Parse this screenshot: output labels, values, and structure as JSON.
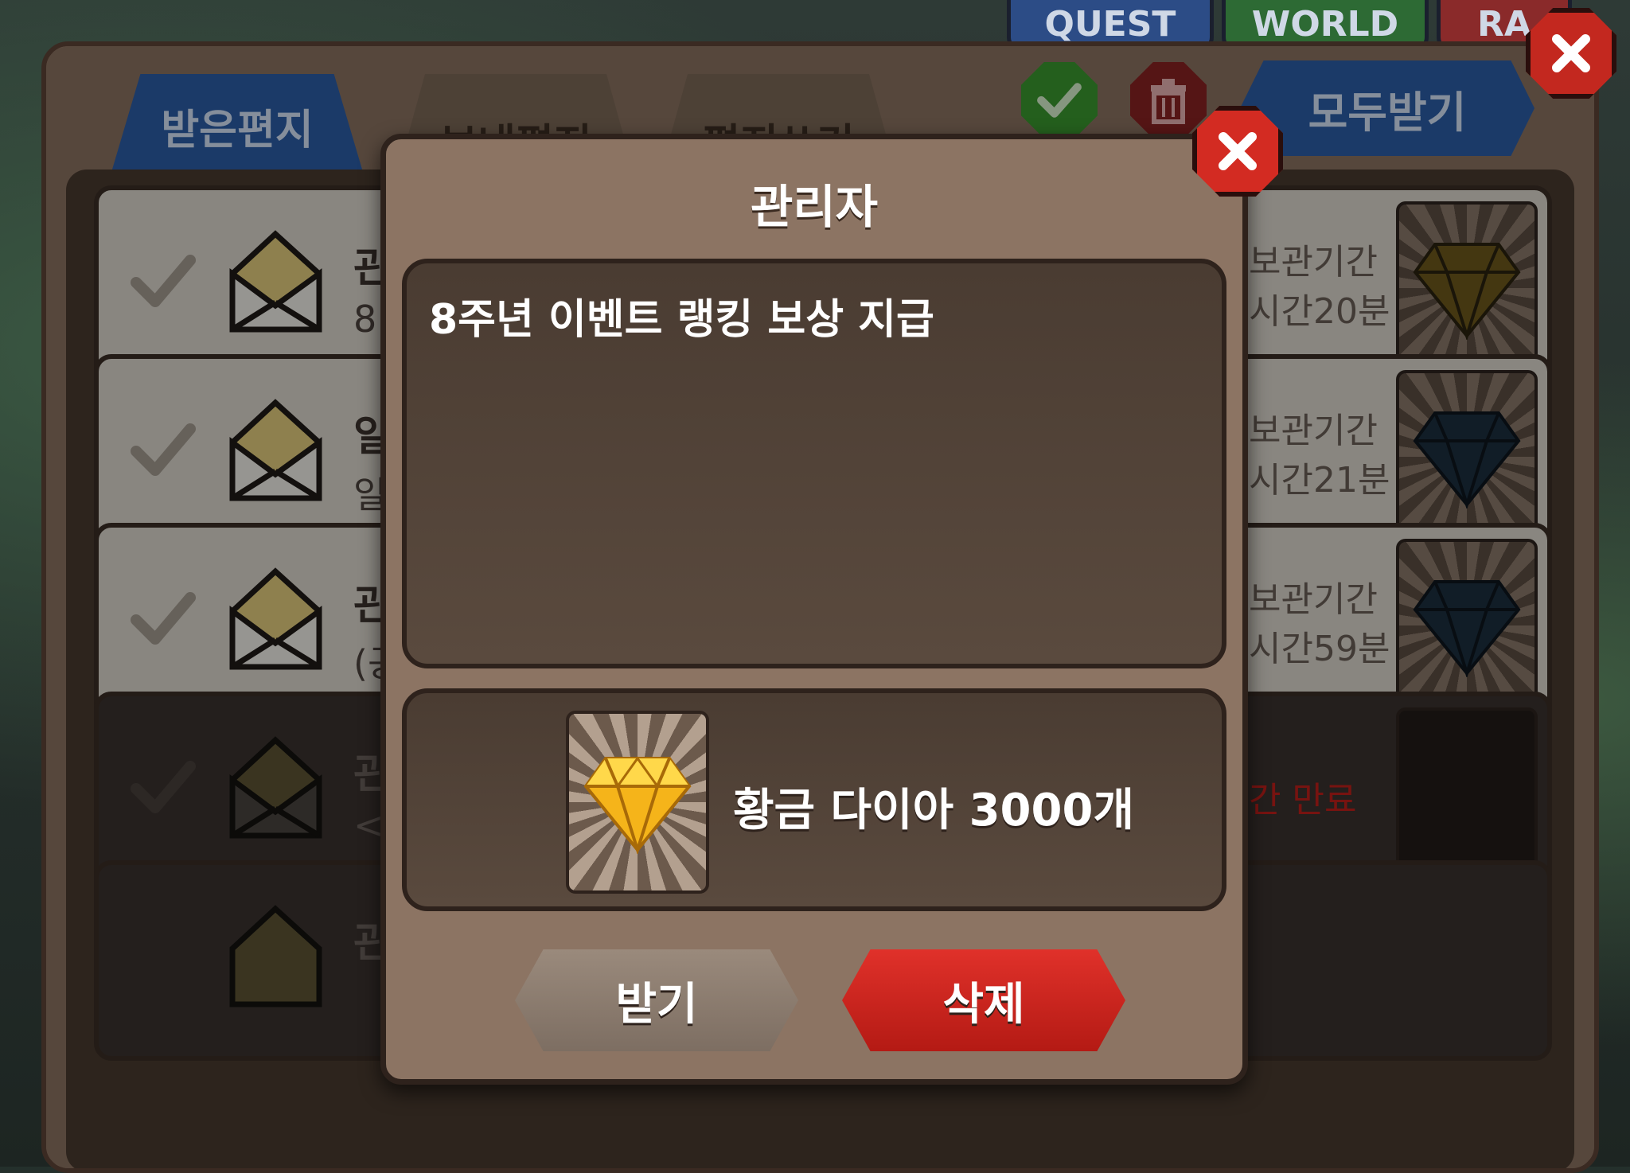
{
  "top_tabs": [
    "QUEST",
    "WORLD",
    "RA"
  ],
  "mailbox": {
    "tabs": [
      "받은편지",
      "보내편지",
      "편지쓰기"
    ],
    "receive_all_label": "모두받기",
    "rows": [
      {
        "sender": "관",
        "preview": "8",
        "expire_line1": "보관기간",
        "expire_line2": "시간20분"
      },
      {
        "sender": "일",
        "preview": "일",
        "expire_line1": "보관기간",
        "expire_line2": "시간21분"
      },
      {
        "sender": "관",
        "preview": "(공",
        "expire_line1": "보관기간",
        "expire_line2": "시간59분"
      },
      {
        "sender": "관",
        "preview": "<",
        "expire_line1": "간 만료",
        "expire_line2": ""
      },
      {
        "sender": "관리자",
        "preview": "",
        "expire_line1": "",
        "expire_line2": ""
      }
    ]
  },
  "dialog": {
    "title": "관리자",
    "message": "8주년 이벤트 랭킹 보상 지급",
    "reward_text": "황금 다이아 3000개",
    "receive_label": "받기",
    "delete_label": "삭제"
  },
  "colors": {
    "tab_active": "#2c5ea8",
    "delete_button": "#d32b22",
    "panel": "#8c7463",
    "gold_diamond": "#f5b41a"
  }
}
